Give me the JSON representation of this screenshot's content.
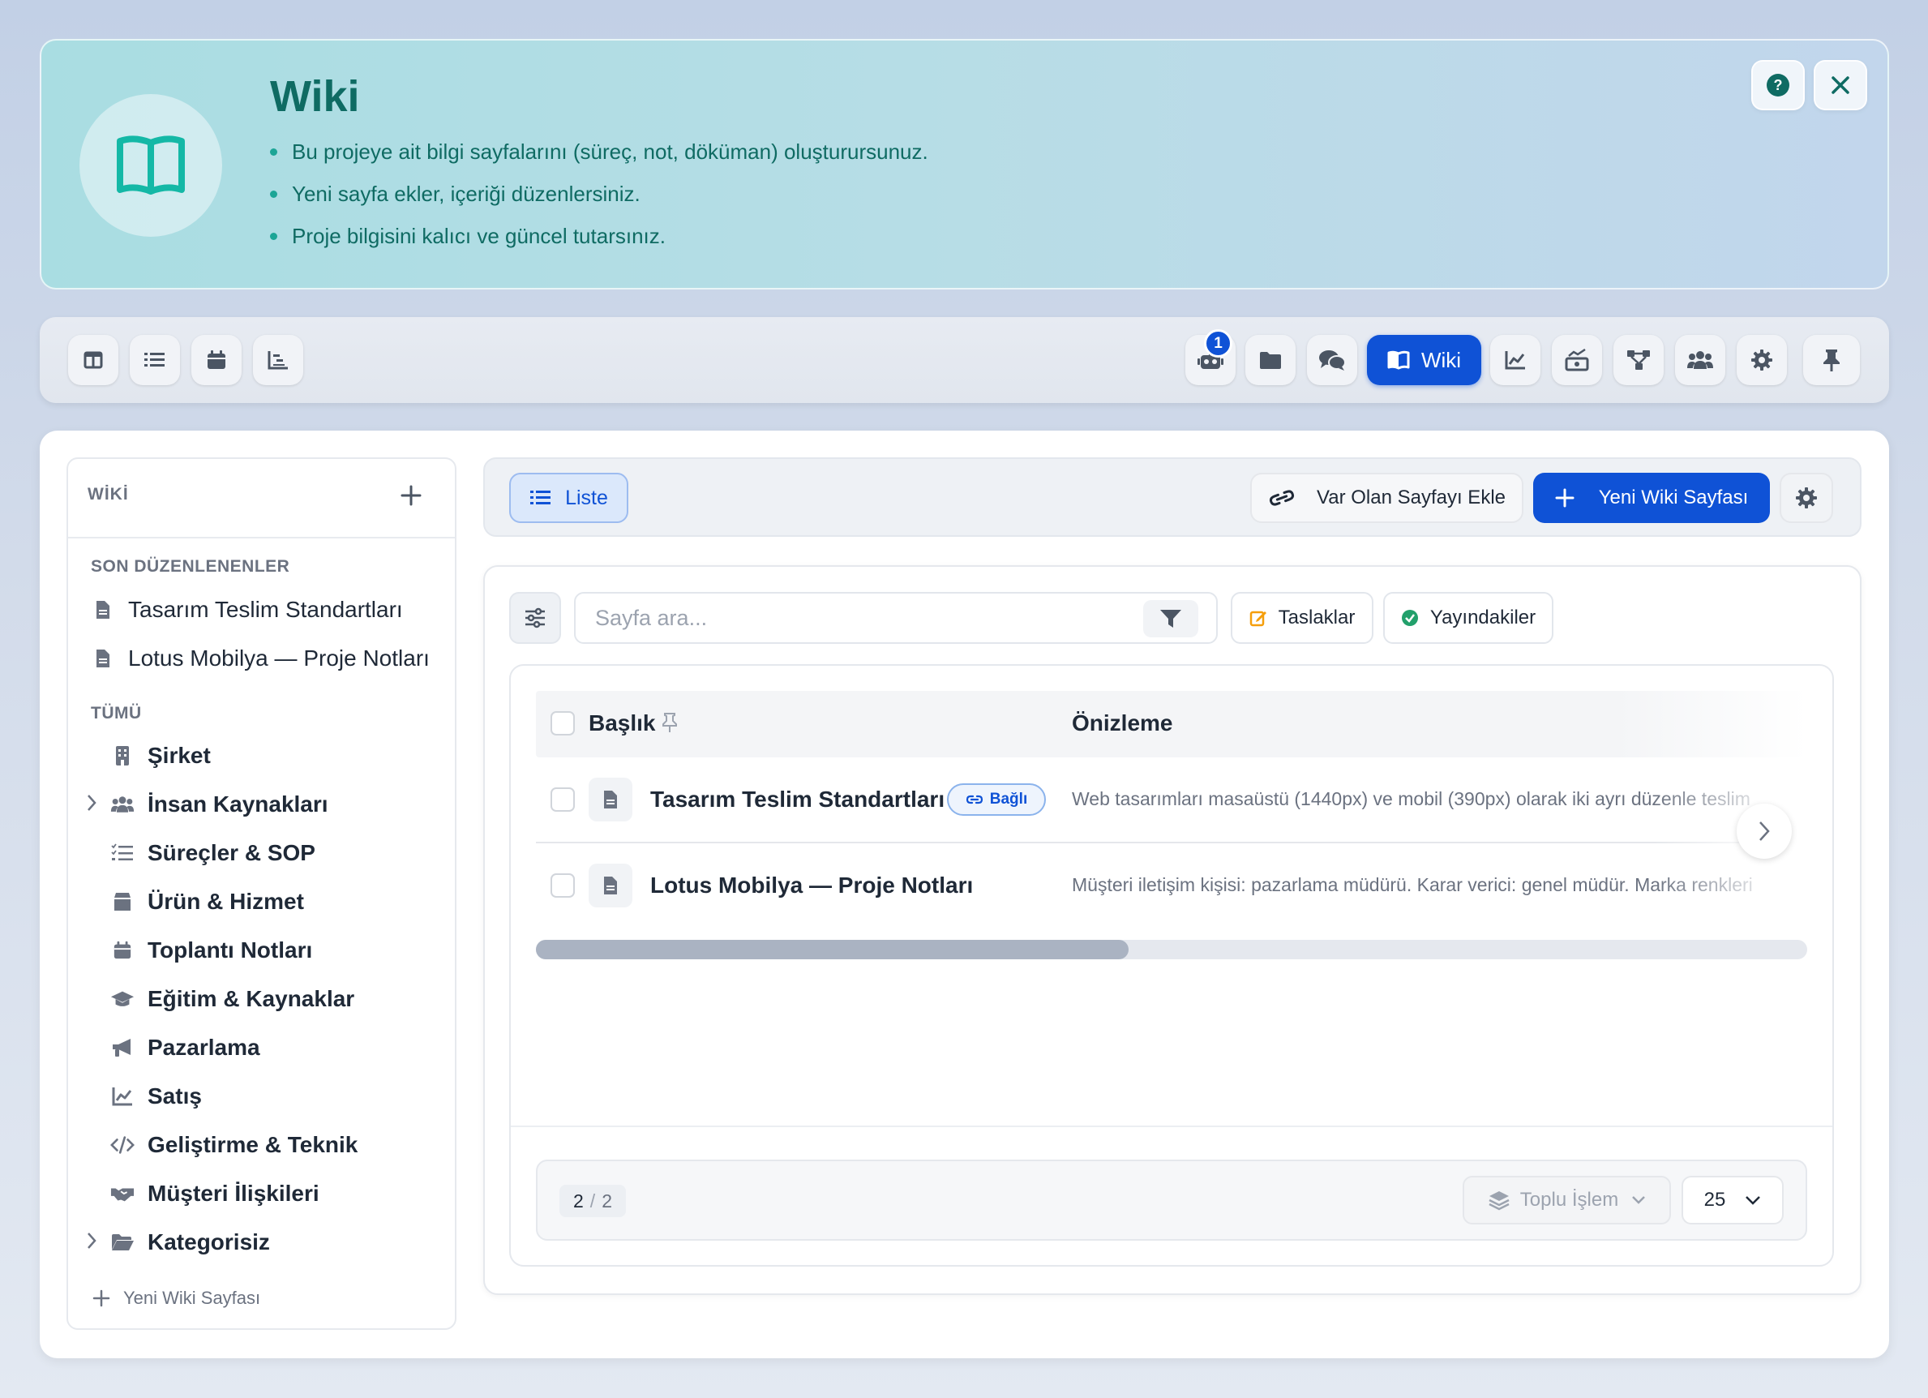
{
  "banner": {
    "title": "Wiki",
    "bullets": [
      "Bu projeye ait bilgi sayfalarını (süreç, not, döküman) oluşturursunuz.",
      "Yeni sayfa ekler, içeriği düzenlersiniz.",
      "Proje bilgisini kalıcı ve güncel tutarsınız."
    ],
    "icon": "book-open-icon"
  },
  "toolbar": {
    "left_icons": [
      "columns-icon",
      "list-icon",
      "calendar-icon",
      "gantt-icon"
    ],
    "right_icons": [
      "robot-icon",
      "folder-icon",
      "comments-icon",
      "chart-line-icon",
      "money-chart-icon",
      "flow-icon",
      "users-icon",
      "gear-icon",
      "pin-icon"
    ],
    "badge": "1",
    "active_tab": "Wiki"
  },
  "sidebar": {
    "title": "WİKİ",
    "recent_header": "SON DÜZENLENENLER",
    "recent": [
      "Tasarım Teslim Standartları",
      "Lotus Mobilya — Proje Notları"
    ],
    "all_header": "TÜMÜ",
    "categories": [
      "Şirket",
      "İnsan Kaynakları",
      "Süreçler & SOP",
      "Ürün & Hizmet",
      "Toplantı Notları",
      "Eğitim & Kaynaklar",
      "Pazarlama",
      "Satış",
      "Geliştirme & Teknik",
      "Müşteri İlişkileri",
      "Kategorisiz"
    ],
    "new_page": "Yeni Wiki Sayfası"
  },
  "actions": {
    "list": "Liste",
    "add_existing": "Var Olan Sayfayı Ekle",
    "new_page": "Yeni Wiki Sayfası"
  },
  "filters": {
    "search_placeholder": "Sayfa ara...",
    "drafts": "Taslaklar",
    "published": "Yayındakiler"
  },
  "table": {
    "col_title": "Başlık",
    "col_preview": "Önizleme",
    "rows": [
      {
        "title": "Tasarım Teslim Standartları",
        "badge": "Bağlı",
        "preview": "Web tasarımları masaüstü (1440px) ve mobil (390px) olarak iki ayrı düzenle teslim"
      },
      {
        "title": "Lotus Mobilya — Proje Notları",
        "badge": "",
        "preview": "Müşteri iletişim kişisi: pazarlama müdürü. Karar verici: genel müdür. Marka renkleri"
      }
    ],
    "scroll_position": 0.47
  },
  "footer": {
    "count_current": "2",
    "count_sep": "/",
    "count_total": "2",
    "bulk": "Toplu İşlem",
    "per_page": "25"
  },
  "colors": {
    "accent": "#0f52d6",
    "teal": "#0f6b63",
    "green": "#22a06b",
    "orange": "#f59e0b"
  }
}
